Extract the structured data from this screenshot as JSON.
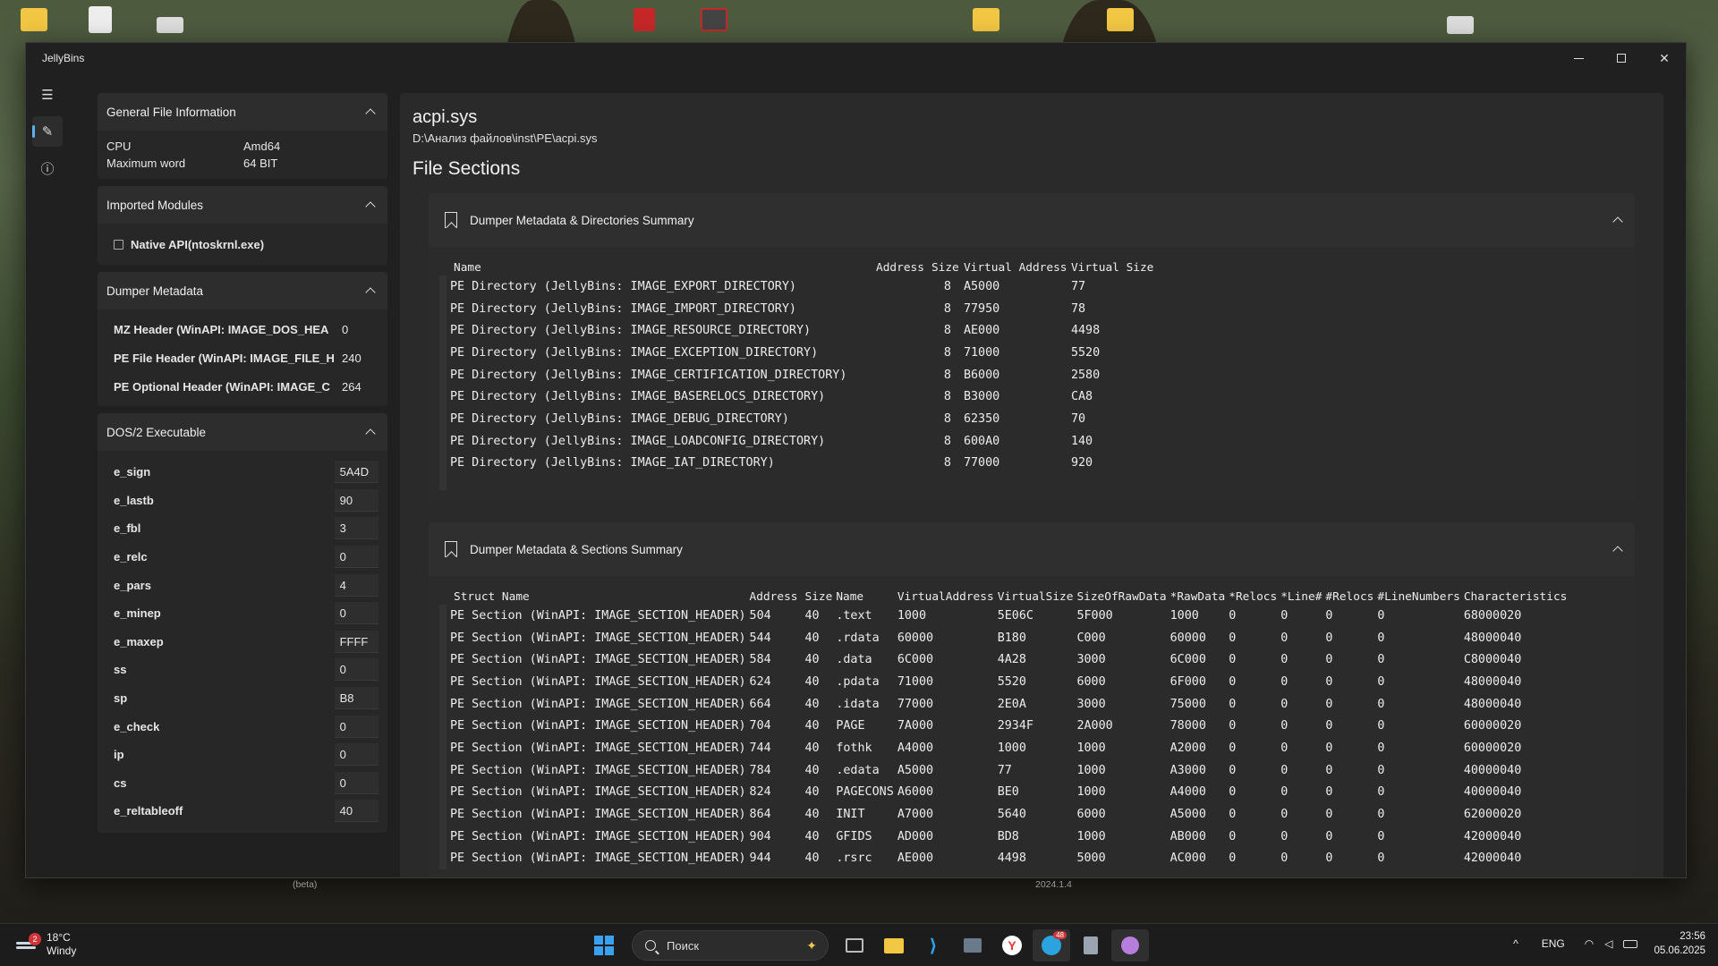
{
  "window": {
    "title": "JellyBins",
    "minimize_icon": "minimize-icon",
    "maximize_icon": "maximize-icon",
    "close_icon": "close-icon",
    "close_glyph": "✕"
  },
  "rail": {
    "menu_glyph": "☰",
    "edit_glyph": "✎",
    "info_glyph": "ⓘ"
  },
  "general": {
    "header": "General File Information",
    "rows": [
      {
        "key": "CPU",
        "value": "Amd64"
      },
      {
        "key": "Maximum word",
        "value": "64 BIT"
      }
    ]
  },
  "imported": {
    "header": "Imported Modules",
    "modules": [
      "Native API(ntoskrnl.exe)"
    ]
  },
  "dumper": {
    "header": "Dumper Metadata",
    "rows": [
      {
        "key": "MZ Header (WinAPI: IMAGE_DOS_HEA",
        "value": "0"
      },
      {
        "key": "PE File Header (WinAPI: IMAGE_FILE_H",
        "value": "240"
      },
      {
        "key": "PE Optional Header (WinAPI: IMAGE_C",
        "value": "264"
      }
    ]
  },
  "dos": {
    "header": "DOS/2 Executable",
    "rows": [
      {
        "key": "e_sign",
        "value": "5A4D"
      },
      {
        "key": "e_lastb",
        "value": "90"
      },
      {
        "key": "e_fbl",
        "value": "3"
      },
      {
        "key": "e_relc",
        "value": "0"
      },
      {
        "key": "e_pars",
        "value": "4"
      },
      {
        "key": "e_minep",
        "value": "0"
      },
      {
        "key": "e_maxep",
        "value": "FFFF"
      },
      {
        "key": "ss",
        "value": "0"
      },
      {
        "key": "sp",
        "value": "B8"
      },
      {
        "key": "e_check",
        "value": "0"
      },
      {
        "key": "ip",
        "value": "0"
      },
      {
        "key": "cs",
        "value": "0"
      },
      {
        "key": "e_reltableoff",
        "value": "40"
      }
    ]
  },
  "main": {
    "file_name": "acpi.sys",
    "file_path": "D:\\Анализ файлов\\inst\\PE\\acpi.sys",
    "section_title": "File Sections"
  },
  "directories": {
    "header": "Dumper Metadata & Directories Summary",
    "columns": [
      "Name",
      "Address",
      "Size",
      "Virtual Address",
      "Virtual Size"
    ],
    "rows": [
      [
        "PE Directory (JellyBins: IMAGE_EXPORT_DIRECTORY)",
        "",
        "8",
        "A5000",
        "77"
      ],
      [
        "PE Directory (JellyBins: IMAGE_IMPORT_DIRECTORY)",
        "",
        "8",
        "77950",
        "78"
      ],
      [
        "PE Directory (JellyBins: IMAGE_RESOURCE_DIRECTORY)",
        "",
        "8",
        "AE000",
        "4498"
      ],
      [
        "PE Directory (JellyBins: IMAGE_EXCEPTION_DIRECTORY)",
        "",
        "8",
        "71000",
        "5520"
      ],
      [
        "PE Directory (JellyBins: IMAGE_CERTIFICATION_DIRECTORY)",
        "",
        "8",
        "B6000",
        "2580"
      ],
      [
        "PE Directory (JellyBins: IMAGE_BASERELOCS_DIRECTORY)",
        "",
        "8",
        "B3000",
        "CA8"
      ],
      [
        "PE Directory (JellyBins: IMAGE_DEBUG_DIRECTORY)",
        "",
        "8",
        "62350",
        "70"
      ],
      [
        "PE Directory (JellyBins: IMAGE_LOADCONFIG_DIRECTORY)",
        "",
        "8",
        "600A0",
        "140"
      ],
      [
        "PE Directory (JellyBins: IMAGE_IAT_DIRECTORY)",
        "",
        "8",
        "77000",
        "920"
      ]
    ]
  },
  "sections": {
    "header": "Dumper Metadata & Sections Summary",
    "columns": [
      "Struct Name",
      "Address",
      "Size",
      "Name",
      "VirtualAddress",
      "VirtualSize",
      "SizeOfRawData",
      "*RawData",
      "*Relocs",
      "*Line#",
      "#Relocs",
      "#LineNumbers",
      "Characteristics"
    ],
    "rows": [
      [
        "PE Section (WinAPI: IMAGE_SECTION_HEADER)",
        "504",
        "40",
        ".text",
        "1000",
        "5E06C",
        "5F000",
        "1000",
        "0",
        "0",
        "0",
        "0",
        "68000020"
      ],
      [
        "PE Section (WinAPI: IMAGE_SECTION_HEADER)",
        "544",
        "40",
        ".rdata",
        "60000",
        "B180",
        "C000",
        "60000",
        "0",
        "0",
        "0",
        "0",
        "48000040"
      ],
      [
        "PE Section (WinAPI: IMAGE_SECTION_HEADER)",
        "584",
        "40",
        ".data",
        "6C000",
        "4A28",
        "3000",
        "6C000",
        "0",
        "0",
        "0",
        "0",
        "C8000040"
      ],
      [
        "PE Section (WinAPI: IMAGE_SECTION_HEADER)",
        "624",
        "40",
        ".pdata",
        "71000",
        "5520",
        "6000",
        "6F000",
        "0",
        "0",
        "0",
        "0",
        "48000040"
      ],
      [
        "PE Section (WinAPI: IMAGE_SECTION_HEADER)",
        "664",
        "40",
        ".idata",
        "77000",
        "2E0A",
        "3000",
        "75000",
        "0",
        "0",
        "0",
        "0",
        "48000040"
      ],
      [
        "PE Section (WinAPI: IMAGE_SECTION_HEADER)",
        "704",
        "40",
        "PAGE",
        "7A000",
        "2934F",
        "2A000",
        "78000",
        "0",
        "0",
        "0",
        "0",
        "60000020"
      ],
      [
        "PE Section (WinAPI: IMAGE_SECTION_HEADER)",
        "744",
        "40",
        "fothk",
        "A4000",
        "1000",
        "1000",
        "A2000",
        "0",
        "0",
        "0",
        "0",
        "60000020"
      ],
      [
        "PE Section (WinAPI: IMAGE_SECTION_HEADER)",
        "784",
        "40",
        ".edata",
        "A5000",
        "77",
        "1000",
        "A3000",
        "0",
        "0",
        "0",
        "0",
        "40000040"
      ],
      [
        "PE Section (WinAPI: IMAGE_SECTION_HEADER)",
        "824",
        "40",
        "PAGECONS",
        "A6000",
        "BE0",
        "1000",
        "A4000",
        "0",
        "0",
        "0",
        "0",
        "40000040"
      ],
      [
        "PE Section (WinAPI: IMAGE_SECTION_HEADER)",
        "864",
        "40",
        "INIT",
        "A7000",
        "5640",
        "6000",
        "A5000",
        "0",
        "0",
        "0",
        "0",
        "62000020"
      ],
      [
        "PE Section (WinAPI: IMAGE_SECTION_HEADER)",
        "904",
        "40",
        "GFIDS",
        "AD000",
        "BD8",
        "1000",
        "AB000",
        "0",
        "0",
        "0",
        "0",
        "42000040"
      ],
      [
        "PE Section (WinAPI: IMAGE_SECTION_HEADER)",
        "944",
        "40",
        ".rsrc",
        "AE000",
        "4498",
        "5000",
        "AC000",
        "0",
        "0",
        "0",
        "0",
        "42000040"
      ]
    ]
  },
  "below_window": {
    "left_label": "(beta)",
    "right_label": "2024.1.4"
  },
  "taskbar": {
    "weather_temp": "18°C",
    "weather_desc": "Windy",
    "weather_badge": "2",
    "search_placeholder": "Поиск",
    "lang": "ENG",
    "time": "23:56",
    "date": "05.06.2025",
    "tray_chevron": "^",
    "telegram_badge": "48",
    "colors": {
      "accent": "#5ab0f0",
      "windows_logo": "#3aa0f0",
      "explorer": "#f2c744",
      "vscode": "#2f9ef0",
      "yandex": "#e53935",
      "telegram": "#2aa3df"
    }
  }
}
